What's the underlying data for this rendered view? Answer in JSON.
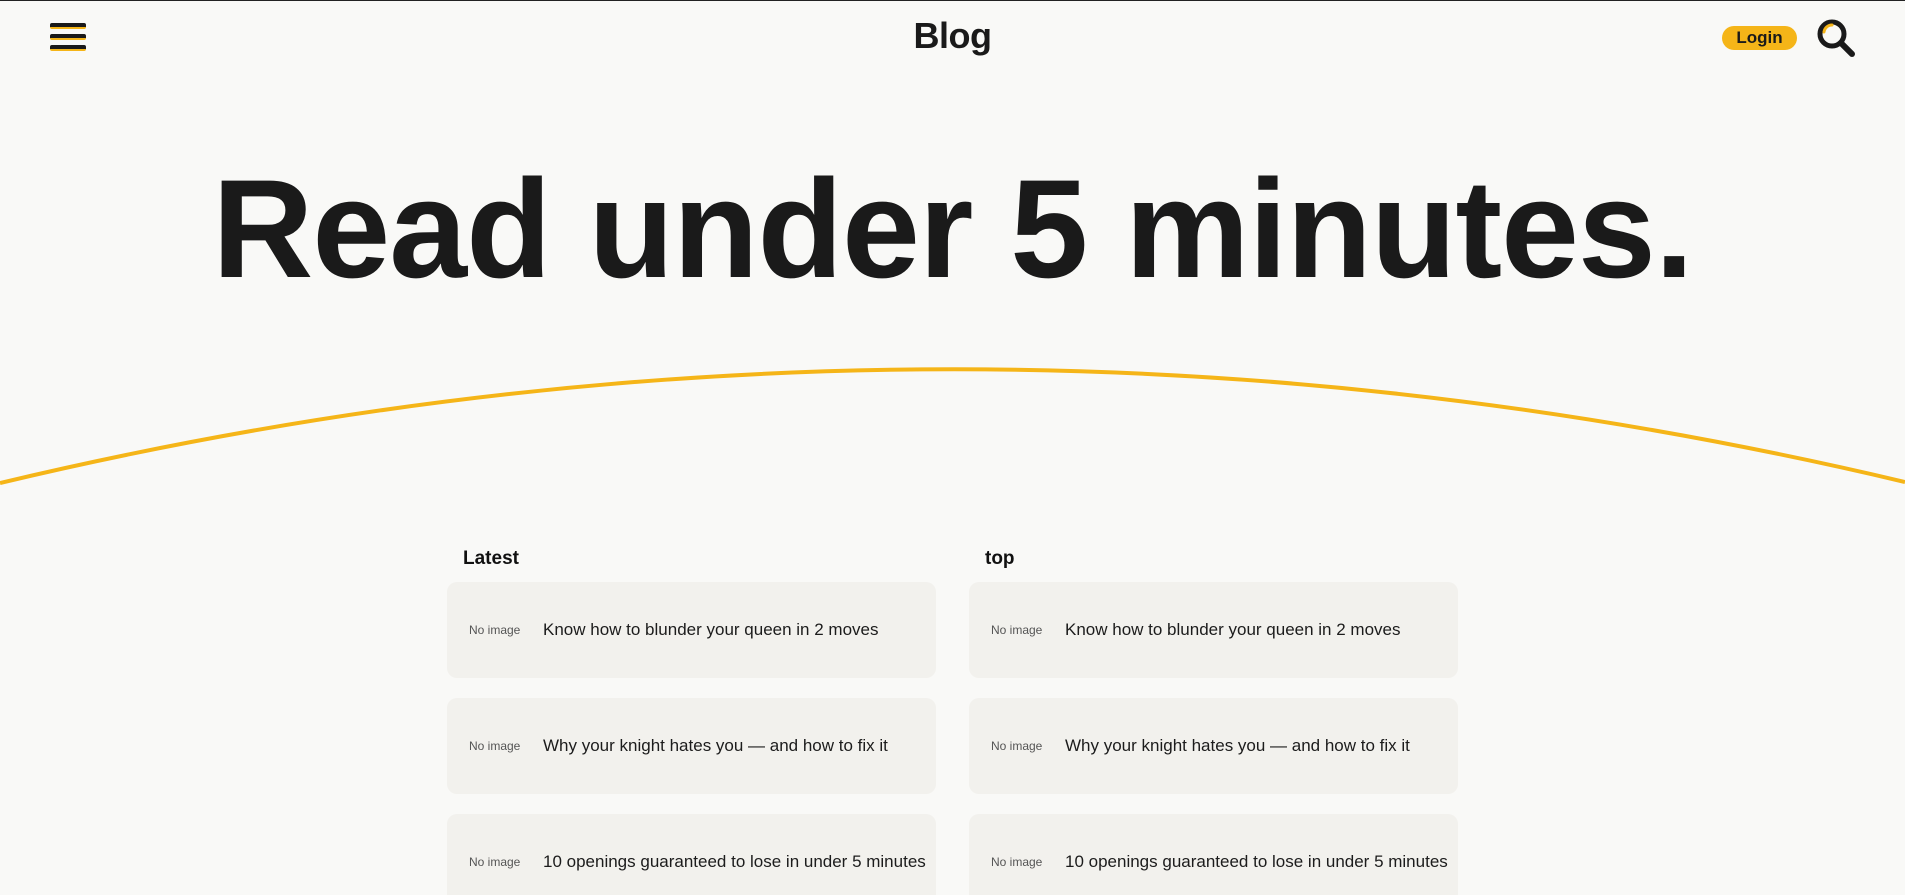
{
  "header": {
    "site_title": "Blog",
    "login_label": "Login",
    "menu_icon": "menu-icon",
    "search_icon": "search-icon"
  },
  "hero": {
    "headline": "Read under 5 minutes."
  },
  "colors": {
    "accent": "#f5b518",
    "text": "#1a1a1a",
    "background": "#f9f9f7",
    "card": "#f2f1ed"
  },
  "columns": [
    {
      "title": "Latest",
      "posts": [
        {
          "image_label": "No image",
          "title": "Know how to blunder your queen in 2 moves"
        },
        {
          "image_label": "No image",
          "title": "Why your knight hates you — and how to fix it"
        },
        {
          "image_label": "No image",
          "title": "10 openings guaranteed to lose in under 5 minutes"
        }
      ]
    },
    {
      "title": "top",
      "posts": [
        {
          "image_label": "No image",
          "title": "Know how to blunder your queen in 2 moves"
        },
        {
          "image_label": "No image",
          "title": "Why your knight hates you — and how to fix it"
        },
        {
          "image_label": "No image",
          "title": "10 openings guaranteed to lose in under 5 minutes"
        }
      ]
    }
  ]
}
